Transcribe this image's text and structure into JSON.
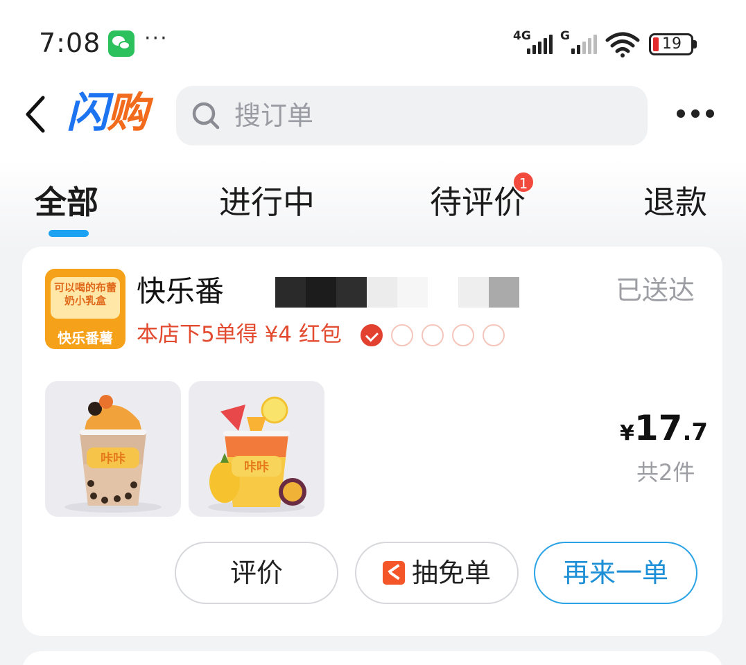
{
  "status_bar": {
    "time": "7:08",
    "more": "···",
    "network1": "4G",
    "network2": "G",
    "battery": "19",
    "battery_color": "#e2292b"
  },
  "header": {
    "logo_first": "闪",
    "logo_rest": "购",
    "search_placeholder": "搜订单"
  },
  "tabs": [
    {
      "label": "全部",
      "active": true
    },
    {
      "label": "进行中",
      "active": false
    },
    {
      "label": "待评价",
      "active": false,
      "badge": "1"
    },
    {
      "label": "退款",
      "active": false
    }
  ],
  "order": {
    "store_name": "快乐番",
    "store_logo_tagline": "可以喝的布蕾 奶小乳盒",
    "store_logo_brand": "快乐番薯",
    "status": "已送达",
    "promo": "本店下5单得 ¥4 红包",
    "promo_progress": {
      "done": 1,
      "total": 5
    },
    "products": [
      {
        "icon": "orange-milk-tea-cup"
      },
      {
        "icon": "fruit-tea-cup"
      }
    ],
    "price_symbol": "¥",
    "price_int": "17",
    "price_dec": ".7",
    "item_count": "共2件",
    "buttons": {
      "review": "评价",
      "lottery": "抽免单",
      "reorder": "再来一单"
    }
  },
  "colors": {
    "accent": "#1da1f2",
    "promo": "#e24b2f",
    "logo_orange": "#f26a1b",
    "logo_blue": "#1d74f0"
  }
}
